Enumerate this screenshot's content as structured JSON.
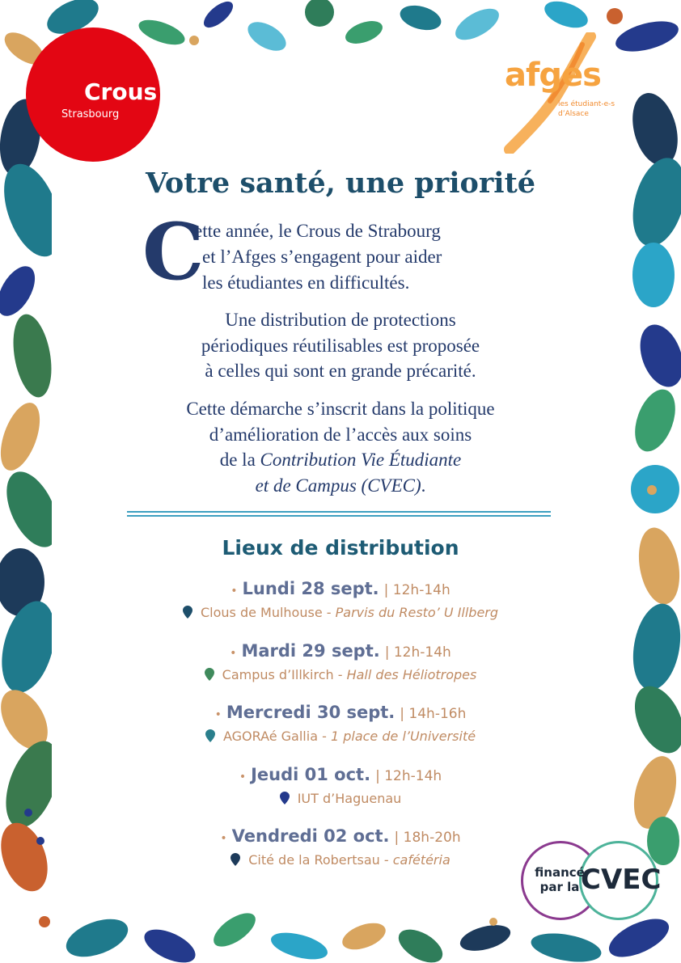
{
  "logos": {
    "crous": {
      "name": "Crous",
      "city": "Strasbourg",
      "color": "#e30613"
    },
    "afges": {
      "name": "afges",
      "tagline_1": "les étudiant-e-s",
      "tagline_2": "d’Alsace",
      "color": "#f6a340"
    }
  },
  "title": "Votre santé, une priorité",
  "intro": {
    "drop_cap": "C",
    "line_1": "ette année, le Crous de Strabourg",
    "line_2": "et l’Afges s’engagent pour aider",
    "line_3": "les étudiantes en difficultés."
  },
  "paragraph_2": {
    "line_1": "Une distribution de protections",
    "line_2": "périodiques réutilisables est proposée",
    "line_3": "à celles qui sont en grande précarité."
  },
  "paragraph_3": {
    "line_1": "Cette démarche s’inscrit dans la politique",
    "line_2": "d’amélioration de l’accès aux soins",
    "line_3_prefix": "de la ",
    "line_3_italic": "Contribution Vie Étudiante",
    "line_4_italic": "et de Campus (CVEC)",
    "line_4_suffix": "."
  },
  "distribution": {
    "heading": "Lieux de distribution",
    "events": [
      {
        "day": "Lundi 28 sept.",
        "time": "| 12h-14h",
        "place": "Clous de Mulhouse - ",
        "detail": "Parvis du Resto’ U Illberg",
        "pin_color": "#1d4e6a"
      },
      {
        "day": "Mardi 29 sept.",
        "time": "| 12h-14h",
        "place": "Campus d’Illkirch - ",
        "detail": "Hall des Héliotropes",
        "pin_color": "#3f8a5c"
      },
      {
        "day": "Mercredi 30 sept.",
        "time": "| 14h-16h",
        "place": "AGORAé Gallia - ",
        "detail": "1 place de l’Université",
        "pin_color": "#2a7f8c"
      },
      {
        "day": "Jeudi 01 oct.",
        "time": "| 12h-14h",
        "place": "IUT d’Haguenau",
        "detail": "",
        "pin_color": "#243a8c"
      },
      {
        "day": "Vendredi 02 oct.",
        "time": "| 18h-20h",
        "place": "Cité de la Robertsau - ",
        "detail": "cafétéria",
        "pin_color": "#1d3a5a"
      }
    ]
  },
  "cvec_badge": {
    "line_1": "financé",
    "line_2": "par la",
    "label": "CVEC"
  }
}
